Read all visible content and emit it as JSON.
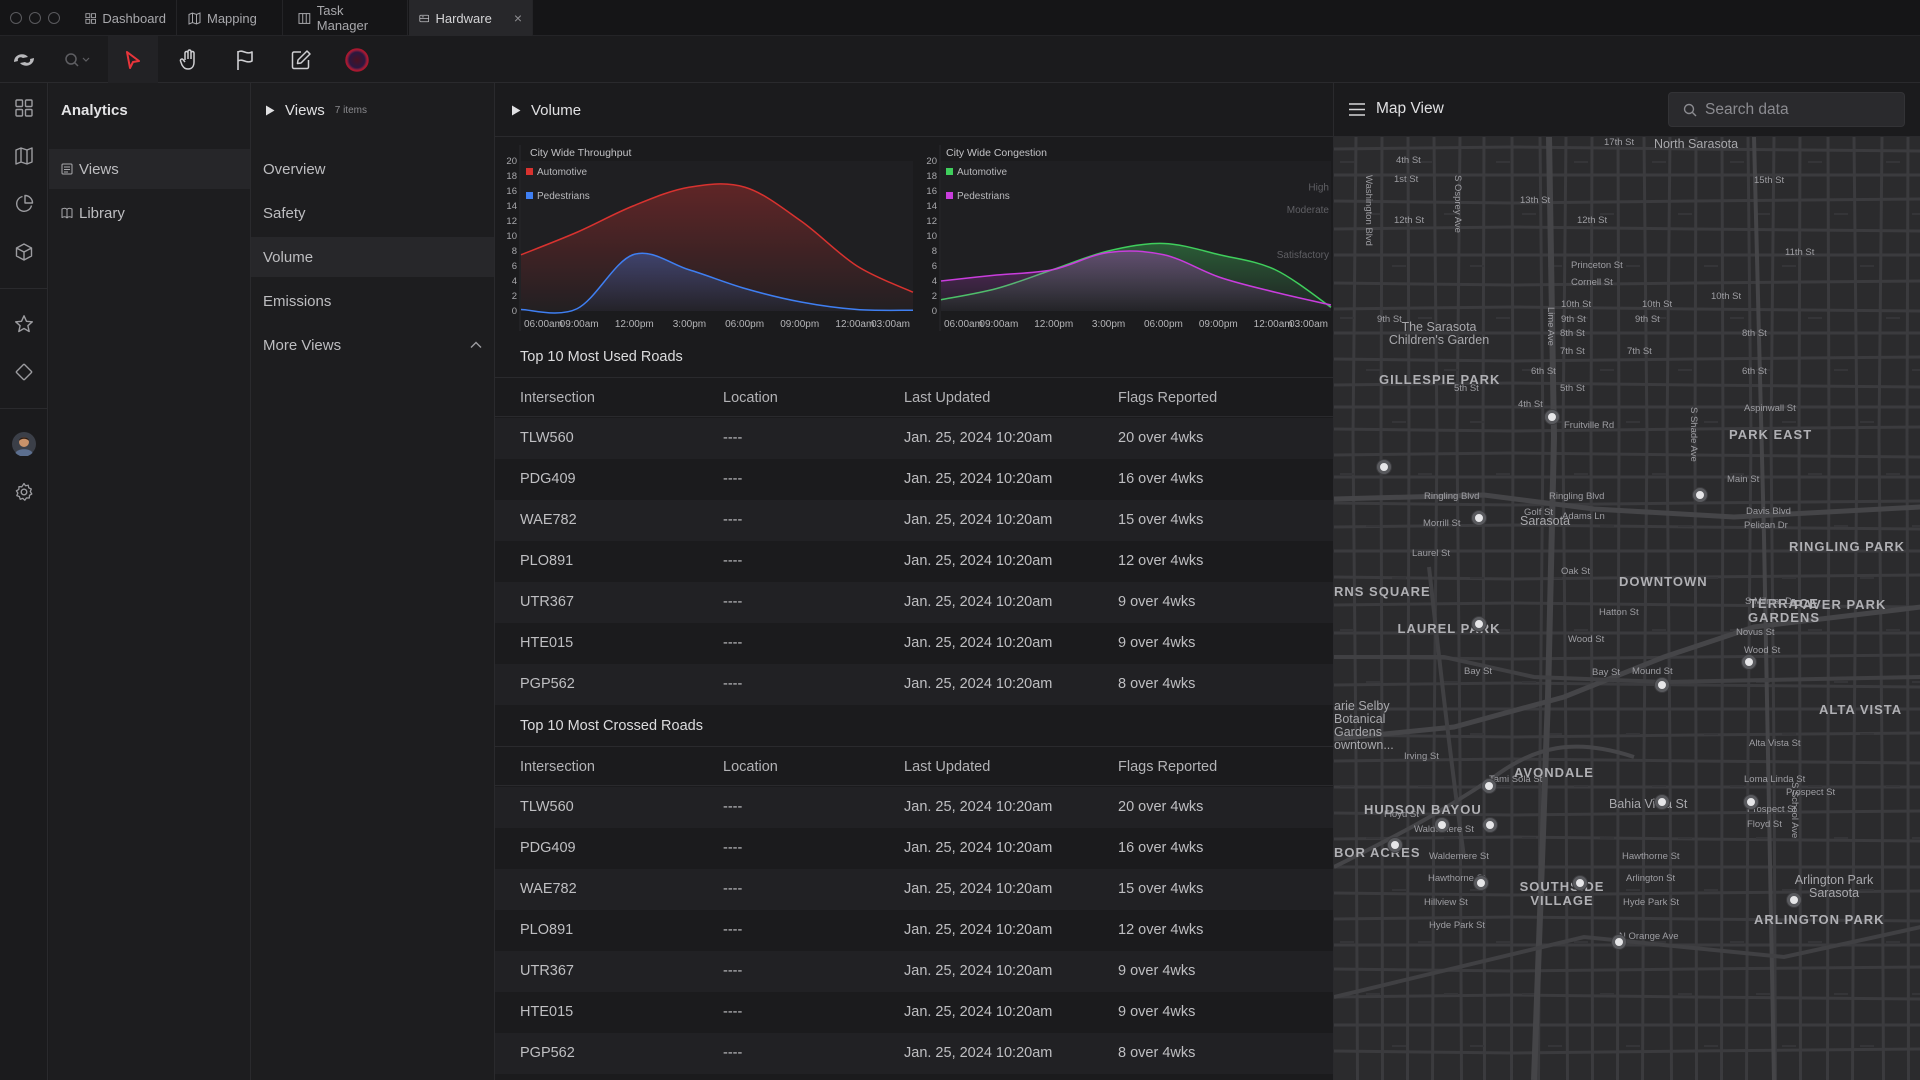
{
  "tabs": [
    {
      "label": "Dashboard",
      "icon": "grid-icon"
    },
    {
      "label": "Mapping",
      "icon": "map-icon"
    },
    {
      "label": "Task Manager",
      "icon": "columns-icon"
    },
    {
      "label": "Hardware",
      "icon": "hardware-icon",
      "active": true
    }
  ],
  "tab_close": "×",
  "toolbar": {
    "tools": [
      "zoom-tool",
      "pointer-tool",
      "hand-tool",
      "flag-tool",
      "edit-tool",
      "record-tool"
    ],
    "accent": "#e8353b"
  },
  "analytics": {
    "title": "Analytics",
    "items": [
      {
        "label": "Views",
        "active": true
      },
      {
        "label": "Library"
      }
    ]
  },
  "views": {
    "title": "Views",
    "count": "7 items",
    "items": [
      {
        "label": "Overview"
      },
      {
        "label": "Safety"
      },
      {
        "label": "Volume",
        "active": true
      },
      {
        "label": "Emissions"
      },
      {
        "label": "More Views"
      }
    ]
  },
  "main": {
    "title": "Volume"
  },
  "chart_data": [
    {
      "type": "area",
      "title": "City Wide Throughput",
      "x": [
        "06:00am",
        "09:00am",
        "12:00pm",
        "3:00pm",
        "06:00pm",
        "09:00pm",
        "12:00am",
        "03:00am"
      ],
      "yticks": [
        20,
        18,
        16,
        14,
        12,
        10,
        8,
        6,
        4,
        2,
        0
      ],
      "ylim": [
        0,
        20
      ],
      "series": [
        {
          "name": "Automotive",
          "color": "#d8322f",
          "values": [
            7.5,
            10.5,
            14,
            16.5,
            16.5,
            12,
            6,
            2.5
          ]
        },
        {
          "name": "Pedestrians",
          "color": "#3f7ff2",
          "values": [
            0.2,
            0.3,
            7.5,
            5.5,
            3,
            1.2,
            0.2,
            0.1
          ]
        }
      ],
      "legend": "top-left"
    },
    {
      "type": "area",
      "title": "City Wide Congestion",
      "x": [
        "06:00am",
        "09:00am",
        "12:00pm",
        "3:00pm",
        "06:00pm",
        "09:00pm",
        "12:00am",
        "03:00am"
      ],
      "yticks": [
        20,
        18,
        16,
        14,
        12,
        10,
        8,
        6,
        4,
        2,
        0
      ],
      "ylim": [
        0,
        20
      ],
      "levels": [
        "High",
        "Moderate",
        "Satisfactory"
      ],
      "series": [
        {
          "name": "Automotive",
          "color": "#3fce5c",
          "values": [
            1.5,
            3,
            5.5,
            8,
            9,
            7.5,
            5.5,
            0.5
          ]
        },
        {
          "name": "Pedestrians",
          "color": "#c93ddd",
          "values": [
            4,
            4.8,
            5.5,
            7.8,
            7.5,
            4.5,
            2.5,
            0.8
          ]
        }
      ],
      "legend": "top-left"
    }
  ],
  "tables": [
    {
      "title": "Top 10 Most Used Roads",
      "columns": [
        "Intersection",
        "Location",
        "Last Updated",
        "Flags Reported"
      ],
      "rows": [
        [
          "TLW560",
          "----",
          "Jan. 25, 2024 10:20am",
          "20 over 4wks"
        ],
        [
          "PDG409",
          "----",
          "Jan. 25, 2024 10:20am",
          "16 over 4wks"
        ],
        [
          "WAE782",
          "----",
          "Jan. 25, 2024 10:20am",
          "15 over 4wks"
        ],
        [
          "PLO891",
          "----",
          "Jan. 25, 2024 10:20am",
          "12 over 4wks"
        ],
        [
          "UTR367",
          "----",
          "Jan. 25, 2024 10:20am",
          "9 over 4wks"
        ],
        [
          "HTE015",
          "----",
          "Jan. 25, 2024 10:20am",
          "9 over 4wks"
        ],
        [
          "PGP562",
          "----",
          "Jan. 25, 2024 10:20am",
          "8 over 4wks"
        ]
      ]
    },
    {
      "title": "Top 10 Most Crossed Roads",
      "columns": [
        "Intersection",
        "Location",
        "Last Updated",
        "Flags Reported"
      ],
      "rows": [
        [
          "TLW560",
          "----",
          "Jan. 25, 2024 10:20am",
          "20 over 4wks"
        ],
        [
          "PDG409",
          "----",
          "Jan. 25, 2024 10:20am",
          "16 over 4wks"
        ],
        [
          "WAE782",
          "----",
          "Jan. 25, 2024 10:20am",
          "15 over 4wks"
        ],
        [
          "PLO891",
          "----",
          "Jan. 25, 2024 10:20am",
          "12 over 4wks"
        ],
        [
          "UTR367",
          "----",
          "Jan. 25, 2024 10:20am",
          "9 over 4wks"
        ],
        [
          "HTE015",
          "----",
          "Jan. 25, 2024 10:20am",
          "9 over 4wks"
        ],
        [
          "PGP562",
          "----",
          "Jan. 25, 2024 10:20am",
          "8 over 4wks"
        ]
      ]
    }
  ],
  "map": {
    "title": "Map View",
    "search_placeholder": "Search data",
    "area_labels": [
      "North Sarasota",
      "GILLESPIE PARK",
      "PARK EAST",
      "Sarasota",
      "DOWNTOWN",
      "RINGLING PARK",
      "RNS SQUARE",
      "LAUREL PARK",
      "TERRACE GARDENS",
      "PAVER PARK",
      "ALTA VISTA",
      "AVONDALE",
      "HUDSON BAYOU",
      "BOR ACRES",
      "SOUTHSIDE VILLAGE",
      "ARLINGTON PARK",
      "Arlington Park Sarasota",
      "The Sarasota Children's Garden",
      "arie Selby Botanical Gardens owntown...",
      "Bahia Vista St"
    ],
    "street_labels": [
      "17th St",
      "4th St",
      "1st St",
      "15th St",
      "13th St",
      "12th St",
      "12th St",
      "11th St",
      "Princeton St",
      "Cornell St",
      "10th St",
      "10th St",
      "10th St",
      "9th St",
      "9th St",
      "9th St",
      "8th St",
      "8th St",
      "7th St",
      "7th St",
      "6th St",
      "6th St",
      "5th St",
      "5th St",
      "4th St",
      "Fruitville Rd",
      "Aspinwall St",
      "Main St",
      "Ringling Blvd",
      "Ringling Blvd",
      "Golf St",
      "Morrill St",
      "Adams Ln",
      "Pelican Dr",
      "Davis Blvd",
      "Laurel St",
      "Oak St",
      "S Milmar Dr",
      "Novus St",
      "Wood St",
      "Wood St",
      "Bay St",
      "Bay St",
      "Mound St",
      "Hatton St",
      "Alta Vista St",
      "Irving St",
      "Tami Sola St",
      "Loma Linda St",
      "Prospect St",
      "Prospect St",
      "Floyd St",
      "Floyd St",
      "Waldemere St",
      "Waldemere St",
      "Hawthorne St",
      "Hawthorne St",
      "Arlington St",
      "Hillview St",
      "Hyde Park St",
      "Hyde Park St",
      "N Orange Ave",
      "Washington Blvd",
      "S Osprey Ave",
      "Lime Ave",
      "S Shade Ave",
      "S School Ave"
    ],
    "pins": 21
  },
  "colors": {
    "accent": "#e8353b",
    "panel": "#1d1d1f",
    "background": "#1b1b1d"
  }
}
